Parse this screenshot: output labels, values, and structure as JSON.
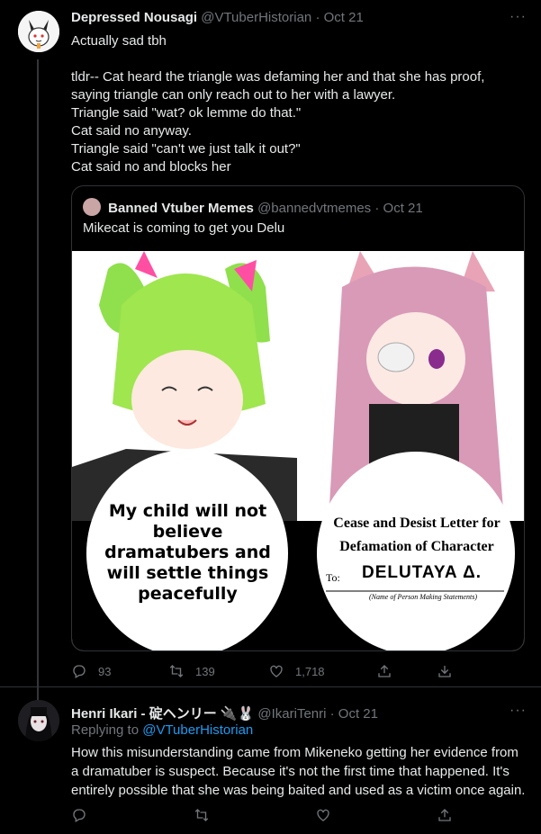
{
  "tweet1": {
    "display_name": "Depressed Nousagi",
    "handle": "@VTuberHistorian",
    "date": "· Oct 21",
    "more": "···",
    "lines": [
      "Actually sad tbh",
      "",
      "tldr-- Cat heard the triangle was defaming her and that she has proof,",
      "saying triangle can only reach out to her with a lawyer.",
      "Triangle said \"wat? ok lemme do that.\"",
      "Cat said no anyway.",
      "Triangle said \"can't we just talk it out?\"",
      "Cat said no and blocks her"
    ],
    "quote": {
      "display_name": "Banned Vtuber Memes",
      "handle": "@bannedvtmemes",
      "date": "· Oct 21",
      "text": "Mikecat is coming to get you Delu",
      "left_caption": [
        "My child will not",
        "believe",
        "dramatubers and",
        "will settle things",
        "peacefully"
      ],
      "right_title": [
        "Cease and Desist Letter for",
        "Defamation of Character"
      ],
      "right_to": "To:",
      "right_name": "DELUTAYA Δ.",
      "right_sub": "(Name of Person Making Statements)"
    },
    "actions": {
      "replies": "93",
      "retweets": "139",
      "likes": "1,718"
    }
  },
  "tweet2": {
    "display_name": "Henri Ikari - 碇ヘンリー 🔌🐰",
    "handle": "@IkariTenri",
    "date": "· Oct 21",
    "more": "···",
    "replying_prefix": "Replying to ",
    "replying_handle": "@VTuberHistorian",
    "lines": [
      "How this misunderstanding came from Mikeneko getting her evidence from",
      "a dramatuber is suspect. Because it's not the first time that happened. It's",
      "entirely possible that she was being baited and used as a victim once again."
    ]
  },
  "colors": {
    "accent": "#1d9bf0",
    "muted": "#71767b",
    "text": "#e7e9ea",
    "border": "#2f3336"
  }
}
